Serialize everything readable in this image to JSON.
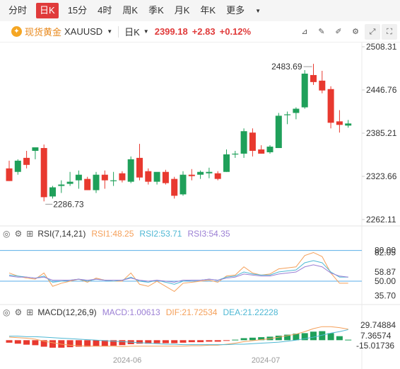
{
  "periods": [
    {
      "label": "分时",
      "active": false
    },
    {
      "label": "日K",
      "active": true
    },
    {
      "label": "15分",
      "active": false
    },
    {
      "label": "4时",
      "active": false
    },
    {
      "label": "周K",
      "active": false
    },
    {
      "label": "季K",
      "active": false
    },
    {
      "label": "月K",
      "active": false
    },
    {
      "label": "年K",
      "active": false
    },
    {
      "label": "更多",
      "active": false
    }
  ],
  "symbol": {
    "name": "现货黄金",
    "code": "XAUUSD",
    "period": "日K",
    "price": "2399.18",
    "change": "+2.83",
    "change_pct": "+0.12%"
  },
  "colors": {
    "up": "#e8392f",
    "down": "#1fa05a",
    "rsi1": "#f5a05a",
    "rsi2": "#4fb8d4",
    "rsi3": "#9b7fd4",
    "macd": "#9b7fd4",
    "dif": "#f5a05a",
    "dea": "#4fb8d4"
  },
  "chart_data": [
    {
      "type": "candlestick",
      "title": "现货黄金 XAUUSD 日K",
      "price_axis_ticks": [
        "2508.31",
        "2446.76",
        "2385.21",
        "2323.66",
        "2262.11"
      ],
      "ylim": [
        2262.11,
        2508.31
      ],
      "high_label": "2483.69",
      "low_label": "2286.73",
      "x_tick_labels": [
        "2024-06",
        "2024-07"
      ],
      "candles": [
        {
          "o": 2335,
          "h": 2346,
          "l": 2317,
          "c": 2317
        },
        {
          "o": 2330,
          "h": 2348,
          "l": 2326,
          "c": 2346
        },
        {
          "o": 2350,
          "h": 2360,
          "l": 2335,
          "c": 2340
        },
        {
          "o": 2360,
          "h": 2363,
          "l": 2348,
          "c": 2365
        },
        {
          "o": 2364,
          "h": 2369,
          "l": 2288,
          "c": 2294
        },
        {
          "o": 2295,
          "h": 2310,
          "l": 2292,
          "c": 2308
        },
        {
          "o": 2310,
          "h": 2318,
          "l": 2300,
          "c": 2312
        },
        {
          "o": 2313,
          "h": 2330,
          "l": 2310,
          "c": 2316
        },
        {
          "o": 2318,
          "h": 2332,
          "l": 2306,
          "c": 2326
        },
        {
          "o": 2320,
          "h": 2323,
          "l": 2304,
          "c": 2304
        },
        {
          "o": 2304,
          "h": 2330,
          "l": 2300,
          "c": 2326
        },
        {
          "o": 2326,
          "h": 2332,
          "l": 2306,
          "c": 2318
        },
        {
          "o": 2318,
          "h": 2330,
          "l": 2310,
          "c": 2318
        },
        {
          "o": 2328,
          "h": 2331,
          "l": 2315,
          "c": 2318
        },
        {
          "o": 2316,
          "h": 2352,
          "l": 2314,
          "c": 2348
        },
        {
          "o": 2350,
          "h": 2370,
          "l": 2318,
          "c": 2322
        },
        {
          "o": 2331,
          "h": 2335,
          "l": 2312,
          "c": 2316
        },
        {
          "o": 2316,
          "h": 2325,
          "l": 2312,
          "c": 2330
        },
        {
          "o": 2330,
          "h": 2333,
          "l": 2312,
          "c": 2314
        },
        {
          "o": 2320,
          "h": 2323,
          "l": 2292,
          "c": 2296
        },
        {
          "o": 2298,
          "h": 2331,
          "l": 2296,
          "c": 2326
        },
        {
          "o": 2326,
          "h": 2334,
          "l": 2318,
          "c": 2324
        },
        {
          "o": 2326,
          "h": 2332,
          "l": 2320,
          "c": 2330
        },
        {
          "o": 2328,
          "h": 2336,
          "l": 2321,
          "c": 2330
        },
        {
          "o": 2328,
          "h": 2331,
          "l": 2318,
          "c": 2320
        },
        {
          "o": 2330,
          "h": 2362,
          "l": 2330,
          "c": 2355
        },
        {
          "o": 2356,
          "h": 2360,
          "l": 2350,
          "c": 2356
        },
        {
          "o": 2356,
          "h": 2392,
          "l": 2350,
          "c": 2388
        },
        {
          "o": 2386,
          "h": 2392,
          "l": 2352,
          "c": 2360
        },
        {
          "o": 2362,
          "h": 2368,
          "l": 2356,
          "c": 2356
        },
        {
          "o": 2358,
          "h": 2368,
          "l": 2356,
          "c": 2366
        },
        {
          "o": 2364,
          "h": 2414,
          "l": 2364,
          "c": 2410
        },
        {
          "o": 2412,
          "h": 2416,
          "l": 2398,
          "c": 2412
        },
        {
          "o": 2414,
          "h": 2422,
          "l": 2405,
          "c": 2420
        },
        {
          "o": 2422,
          "h": 2475,
          "l": 2420,
          "c": 2470
        },
        {
          "o": 2468,
          "h": 2484,
          "l": 2454,
          "c": 2458
        },
        {
          "o": 2460,
          "h": 2474,
          "l": 2442,
          "c": 2446
        },
        {
          "o": 2448,
          "h": 2452,
          "l": 2392,
          "c": 2400
        },
        {
          "o": 2402,
          "h": 2418,
          "l": 2386,
          "c": 2397
        },
        {
          "o": 2396,
          "h": 2404,
          "l": 2393,
          "c": 2399
        }
      ]
    },
    {
      "type": "line",
      "title": "RSI(7,14,21)",
      "series": [
        {
          "name": "RSI1:48.25",
          "values": [
            58,
            55,
            53,
            52,
            58,
            45,
            48,
            50,
            52,
            49,
            53,
            51,
            50,
            50,
            58,
            47,
            45,
            50,
            45,
            40,
            48,
            49,
            50,
            51,
            49,
            55,
            56,
            64,
            58,
            56,
            57,
            62,
            63,
            64,
            75,
            78,
            74,
            58,
            48,
            48
          ]
        },
        {
          "name": "RSI2:53.71",
          "values": [
            56,
            55,
            54,
            53,
            55,
            49,
            50,
            51,
            52,
            50,
            52,
            51,
            50,
            51,
            54,
            50,
            49,
            51,
            49,
            47,
            50,
            51,
            51,
            52,
            51,
            54,
            55,
            59,
            57,
            56,
            56,
            59,
            60,
            61,
            68,
            70,
            68,
            59,
            54,
            54
          ]
        },
        {
          "name": "RSI3:54.35",
          "values": [
            55,
            54,
            54,
            53,
            54,
            51,
            51,
            51,
            52,
            51,
            52,
            51,
            51,
            51,
            53,
            51,
            50,
            51,
            50,
            49,
            51,
            51,
            51,
            52,
            51,
            53,
            54,
            57,
            56,
            55,
            55,
            57,
            58,
            59,
            64,
            66,
            64,
            58,
            55,
            54
          ]
        }
      ],
      "axis_ticks": [
        "80.00",
        "82.05",
        "58.87",
        "50.00",
        "35.70"
      ],
      "ylim": [
        30,
        88
      ]
    },
    {
      "type": "bar",
      "title": "MACD(12,26,9)",
      "series": [
        {
          "name": "MACD:1.00613",
          "values": [
            -5,
            -7,
            -9,
            -10,
            -13,
            -15,
            -15,
            -14,
            -13,
            -13,
            -12,
            -12,
            -11,
            -10,
            -8,
            -7,
            -7,
            -6,
            -6,
            -6,
            -5,
            -4,
            -4,
            -3,
            -3,
            -1,
            1,
            4,
            5,
            6,
            7,
            9,
            11,
            13,
            14,
            17,
            18,
            14,
            8,
            1
          ]
        },
        {
          "name": "DIF:21.72534",
          "values": [
            6,
            5,
            4,
            2,
            -2,
            -5,
            -8,
            -10,
            -11,
            -12,
            -12,
            -12,
            -12,
            -13,
            -12,
            -12,
            -12,
            -12,
            -12,
            -12,
            -12,
            -11,
            -11,
            -10,
            -10,
            -8,
            -6,
            -3,
            -1,
            1,
            3,
            6,
            9,
            12,
            17,
            23,
            27,
            27,
            25,
            22
          ]
        },
        {
          "name": "DEA:21.22228",
          "values": [
            8,
            8,
            7,
            7,
            6,
            5,
            4,
            3,
            2,
            1,
            0,
            -1,
            -2,
            -3,
            -4,
            -5,
            -6,
            -7,
            -8,
            -8,
            -9,
            -9,
            -9,
            -9,
            -9,
            -9,
            -8,
            -8,
            -7,
            -6,
            -5,
            -4,
            -2,
            0,
            3,
            6,
            10,
            14,
            17,
            21
          ]
        }
      ],
      "axis_ticks": [
        "29.74884",
        "7.36574",
        "-15.01736"
      ],
      "ylim": [
        -25,
        40
      ]
    }
  ]
}
